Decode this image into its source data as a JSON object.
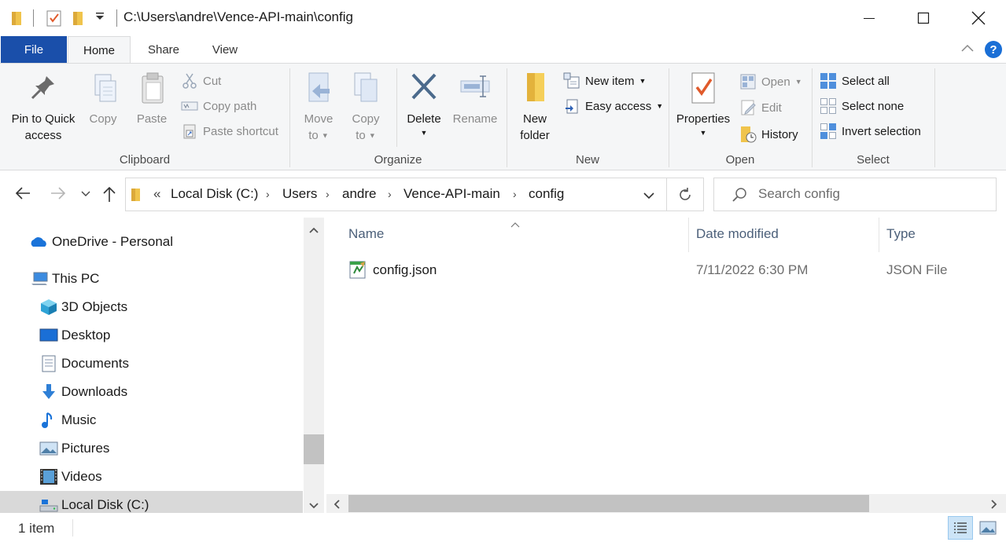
{
  "window": {
    "title": "C:\\Users\\andre\\Vence-API-main\\config",
    "controls": [
      "minimize",
      "maximize",
      "close"
    ]
  },
  "quick_access_toolbar": {
    "icons": [
      "folder-icon",
      "properties-icon",
      "new-folder-icon",
      "customize-dropdown-icon"
    ]
  },
  "ribbon_tabs": [
    {
      "label": "File"
    },
    {
      "label": "Home",
      "active": true
    },
    {
      "label": "Share"
    },
    {
      "label": "View"
    }
  ],
  "ribbon": {
    "clipboard": {
      "group_label": "Clipboard",
      "pin_to_quick_access": "Pin to Quick access",
      "pin_line1": "Pin to Quick",
      "pin_line2": "access",
      "copy": "Copy",
      "paste": "Paste",
      "cut": "Cut",
      "copy_path": "Copy path",
      "paste_shortcut": "Paste shortcut"
    },
    "organize": {
      "group_label": "Organize",
      "move_to_line1": "Move",
      "move_to_line2": "to",
      "copy_to_line1": "Copy",
      "copy_to_line2": "to",
      "delete": "Delete",
      "rename": "Rename"
    },
    "new": {
      "group_label": "New",
      "new_folder_line1": "New",
      "new_folder_line2": "folder",
      "new_item": "New item",
      "easy_access": "Easy access"
    },
    "open": {
      "group_label": "Open",
      "properties": "Properties",
      "open": "Open",
      "edit": "Edit",
      "history": "History"
    },
    "select": {
      "group_label": "Select",
      "select_all": "Select all",
      "select_none": "Select none",
      "invert_selection": "Invert selection"
    }
  },
  "address_bar": {
    "overflow": "«",
    "crumbs": [
      "Local Disk (C:)",
      "Users",
      "andre",
      "Vence-API-main",
      "config"
    ]
  },
  "search": {
    "placeholder": "Search config"
  },
  "nav_pane": {
    "items": [
      {
        "label": "OneDrive - Personal",
        "icon": "onedrive-icon"
      },
      {
        "label": "This PC",
        "icon": "this-pc-icon"
      },
      {
        "label": "3D Objects",
        "icon": "3d-objects-icon"
      },
      {
        "label": "Desktop",
        "icon": "desktop-icon"
      },
      {
        "label": "Documents",
        "icon": "documents-icon"
      },
      {
        "label": "Downloads",
        "icon": "downloads-icon"
      },
      {
        "label": "Music",
        "icon": "music-icon"
      },
      {
        "label": "Pictures",
        "icon": "pictures-icon"
      },
      {
        "label": "Videos",
        "icon": "videos-icon"
      },
      {
        "label": "Local Disk (C:)",
        "icon": "local-disk-icon",
        "selected": true
      }
    ]
  },
  "file_list": {
    "columns": [
      "Name",
      "Date modified",
      "Type"
    ],
    "rows": [
      {
        "name": "config.json",
        "date_modified": "7/11/2022 6:30 PM",
        "type": "JSON File",
        "icon": "json-file-icon"
      }
    ]
  },
  "status_bar": {
    "item_count": "1 item"
  },
  "colors": {
    "file_tab": "#1a4faa",
    "ribbon_bg": "#f5f6f7",
    "column_header_text": "#4c607a",
    "selected_nav_bg": "#d9d9d9",
    "help_icon": "#1a6fd6"
  }
}
